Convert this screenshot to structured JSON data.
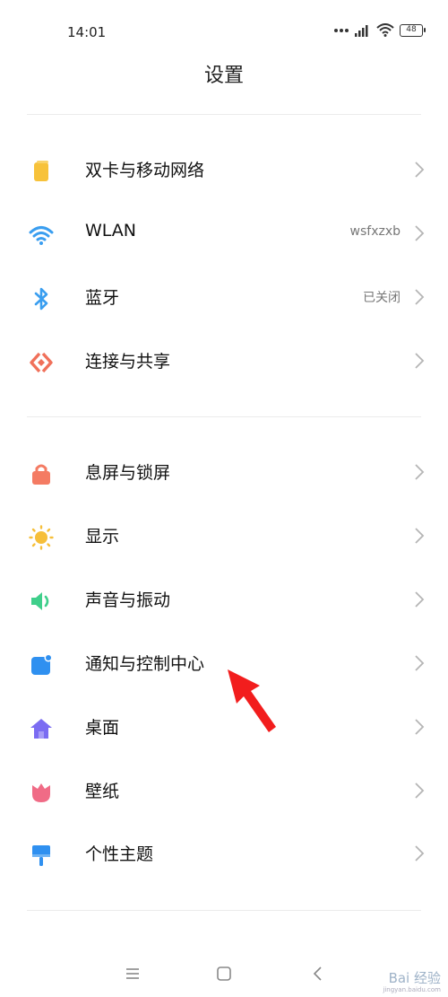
{
  "status": {
    "time": "14:01",
    "battery": "48"
  },
  "title": "设置",
  "rows": [
    {
      "label": "双卡与移动网络",
      "value": ""
    },
    {
      "label": "WLAN",
      "value": "wsfxzxb"
    },
    {
      "label": "蓝牙",
      "value": "已关闭"
    },
    {
      "label": "连接与共享",
      "value": ""
    },
    {
      "label": "息屏与锁屏",
      "value": ""
    },
    {
      "label": "显示",
      "value": ""
    },
    {
      "label": "声音与振动",
      "value": ""
    },
    {
      "label": "通知与控制中心",
      "value": ""
    },
    {
      "label": "桌面",
      "value": ""
    },
    {
      "label": "壁纸",
      "value": ""
    },
    {
      "label": "个性主题",
      "value": ""
    }
  ],
  "icons": [
    "sim-card-icon",
    "wifi-icon",
    "bluetooth-icon",
    "share-icon",
    "lock-icon",
    "sun-icon",
    "speaker-icon",
    "notification-icon",
    "home-icon",
    "tulip-icon",
    "paintbrush-icon"
  ],
  "colors": {
    "sim": "#f7c23a",
    "wifi": "#3a9ef0",
    "share": "#f0705a",
    "lock": "#f47b63",
    "sun": "#f6bf3a",
    "sound": "#3fcf8b",
    "notify": "#2f90f0",
    "home": "#7b6cf2",
    "wallpaper": "#f06b86",
    "theme": "#2f90f0",
    "annotation": "#f21d1d"
  },
  "watermark": {
    "text": "Bai 经验",
    "sub": "jingyan.baidu.com"
  }
}
